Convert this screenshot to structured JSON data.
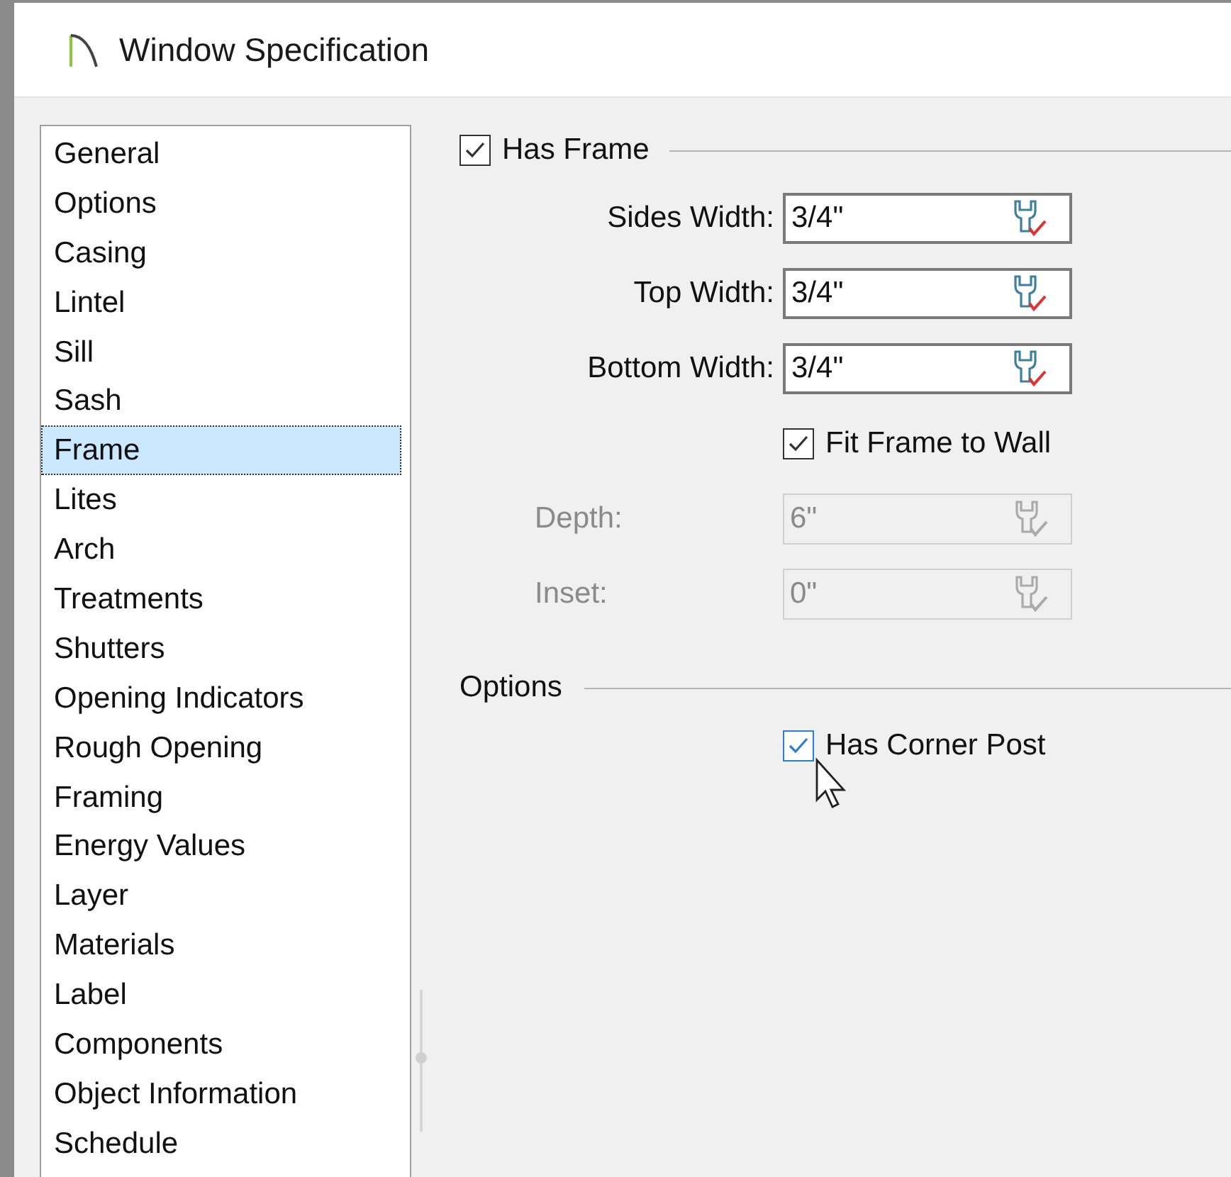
{
  "window": {
    "title": "Window Specification"
  },
  "sidebar": {
    "items": [
      {
        "label": "General",
        "selected": false
      },
      {
        "label": "Options",
        "selected": false
      },
      {
        "label": "Casing",
        "selected": false
      },
      {
        "label": "Lintel",
        "selected": false
      },
      {
        "label": "Sill",
        "selected": false
      },
      {
        "label": "Sash",
        "selected": false
      },
      {
        "label": "Frame",
        "selected": true
      },
      {
        "label": "Lites",
        "selected": false
      },
      {
        "label": "Arch",
        "selected": false
      },
      {
        "label": "Treatments",
        "selected": false
      },
      {
        "label": "Shutters",
        "selected": false
      },
      {
        "label": "Opening Indicators",
        "selected": false
      },
      {
        "label": "Rough Opening",
        "selected": false
      },
      {
        "label": "Framing",
        "selected": false
      },
      {
        "label": "Energy Values",
        "selected": false
      },
      {
        "label": "Layer",
        "selected": false
      },
      {
        "label": "Materials",
        "selected": false
      },
      {
        "label": "Label",
        "selected": false
      },
      {
        "label": "Components",
        "selected": false
      },
      {
        "label": "Object Information",
        "selected": false
      },
      {
        "label": "Schedule",
        "selected": false
      }
    ]
  },
  "frame": {
    "label": "Has Frame",
    "checked": true,
    "rows": [
      {
        "kind": "field",
        "label": "Sides Width:",
        "value": "3/4\"",
        "disabled": false
      },
      {
        "kind": "field",
        "label": "Top Width:",
        "value": "3/4\"",
        "disabled": false
      },
      {
        "kind": "field",
        "label": "Bottom Width:",
        "value": "3/4\"",
        "disabled": false
      },
      {
        "kind": "checkbox",
        "label": "Fit Frame to Wall",
        "checked": true
      },
      {
        "kind": "field",
        "label": "Depth:",
        "value": "6\"",
        "disabled": true
      },
      {
        "kind": "field",
        "label": "Inset:",
        "value": "0\"",
        "disabled": true
      }
    ]
  },
  "options": {
    "title": "Options",
    "checkboxes": [
      {
        "label": "Has Corner Post",
        "checked": true,
        "focused": true
      }
    ]
  }
}
